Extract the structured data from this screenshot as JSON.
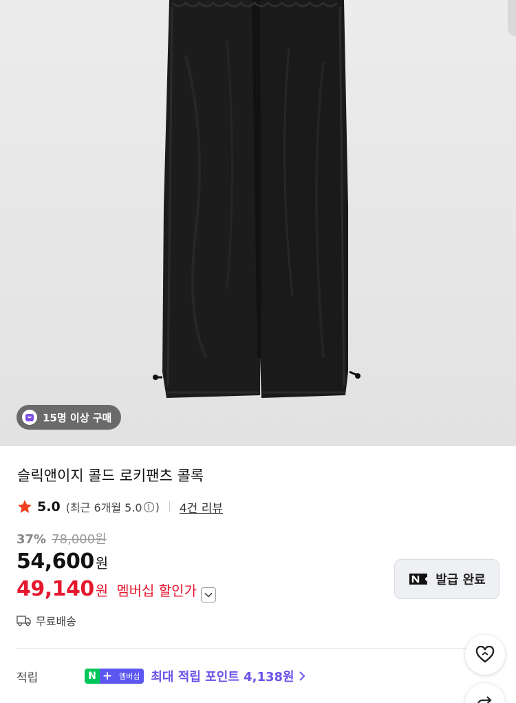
{
  "product": {
    "buyers_badge": "15명 이상 구매",
    "title": "슬릭앤이지 콜드 로키팬츠 콜록",
    "rating": "5.0",
    "rating_detail_prefix": "(최근 6개월 5.0",
    "rating_detail_suffix": ")",
    "review_link": "4건 리뷰",
    "discount_rate": "37%",
    "original_price": "78,000원",
    "price": "54,600",
    "price_unit": "원",
    "member_price": "49,140",
    "member_unit": "원",
    "member_label": "멤버십 할인가"
  },
  "coupon": {
    "label": "발급 완료"
  },
  "shipping": {
    "label": "무료배송"
  },
  "points": {
    "label": "적립",
    "badge_n": "N",
    "badge_plus": "+",
    "badge_membership": "멤버십",
    "text": "최대 적립 포인트 4,138원"
  },
  "colors": {
    "accent_red": "#e5182e",
    "points_purple": "#6b52e8",
    "naver_green": "#03c75a"
  }
}
